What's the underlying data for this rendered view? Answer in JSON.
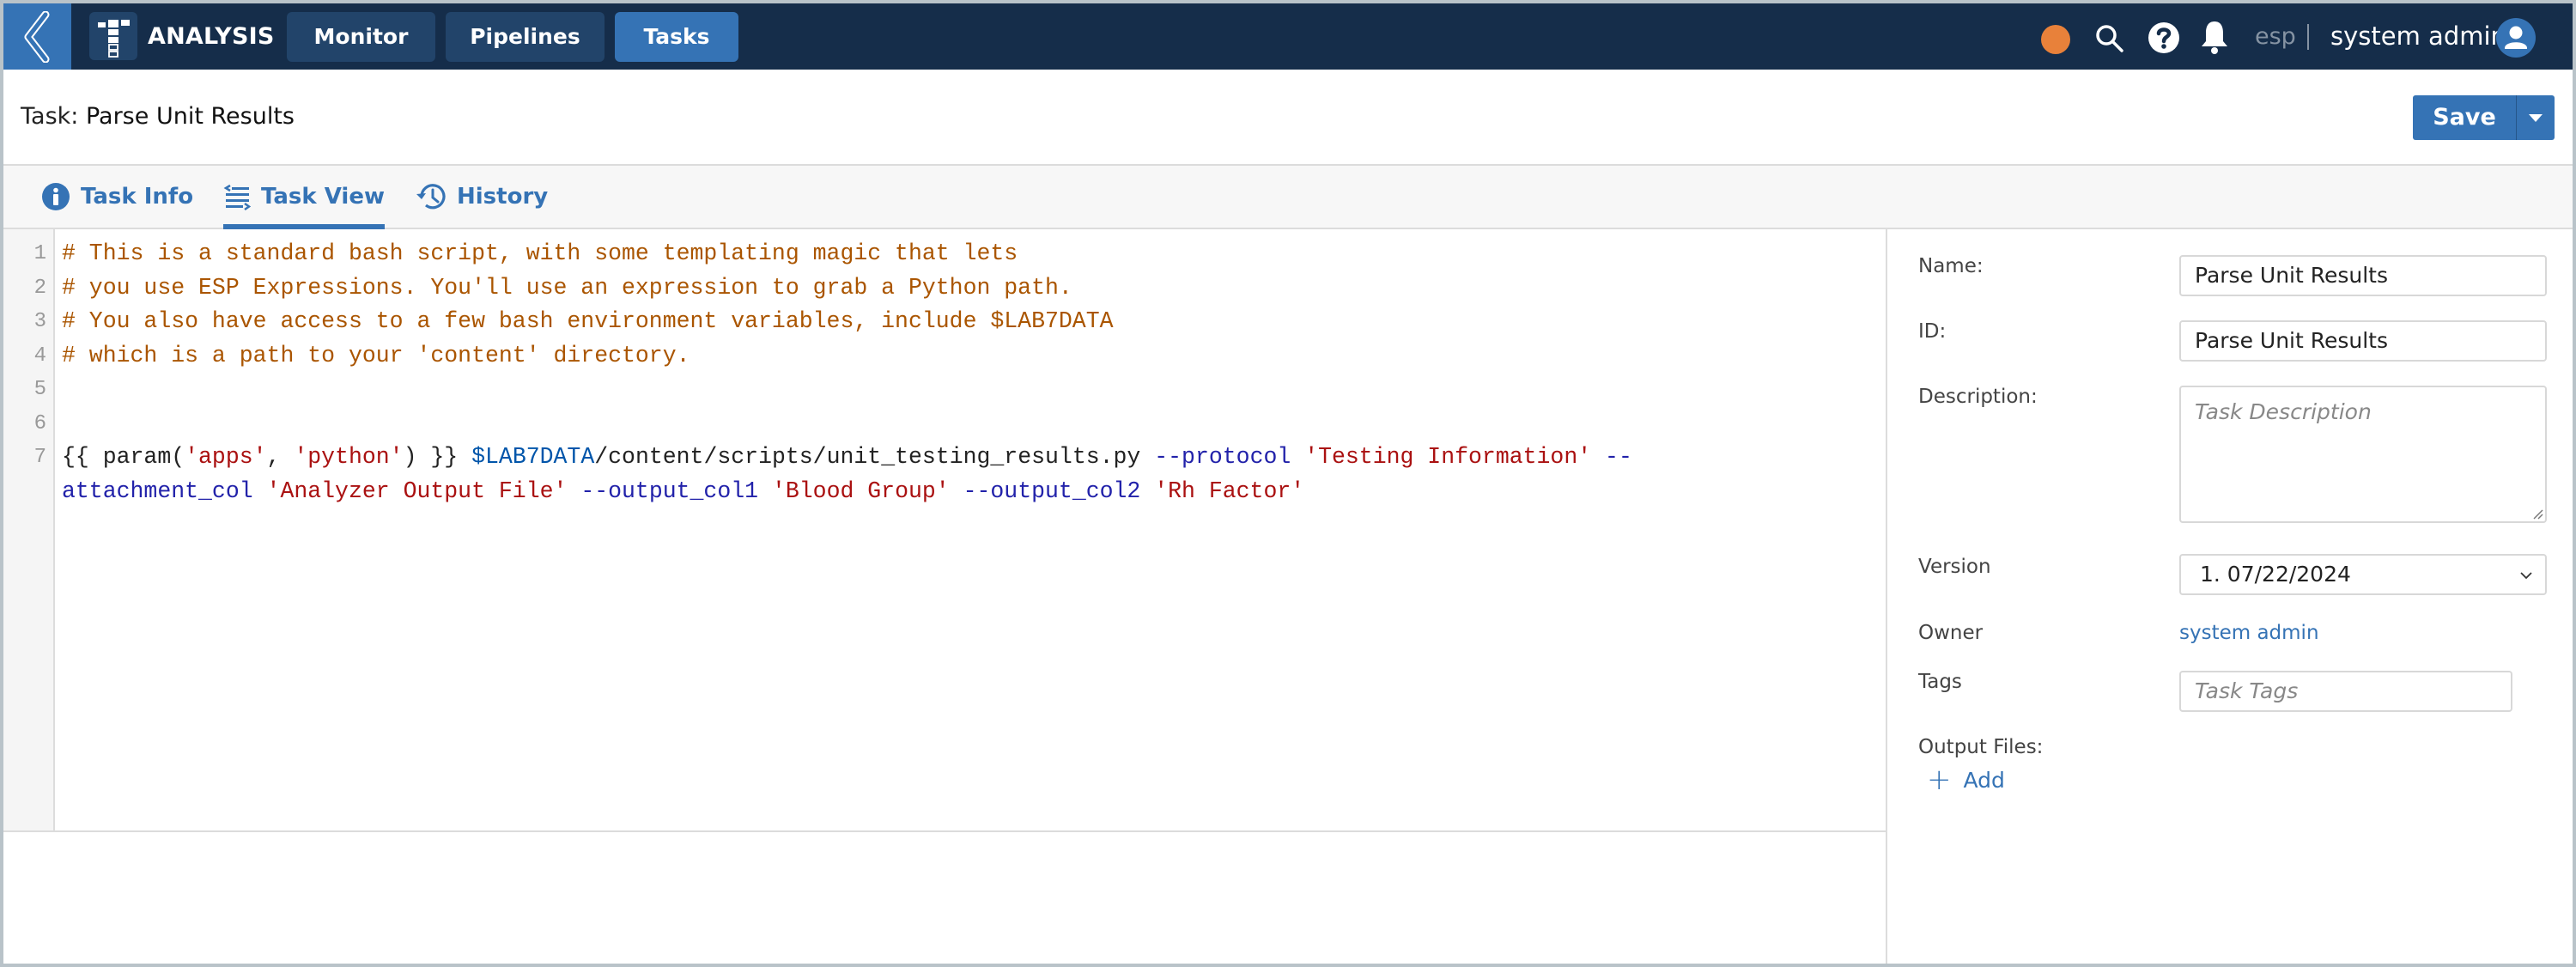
{
  "header": {
    "app_name": "ANALYSIS",
    "nav": [
      {
        "label": "Monitor",
        "active": false
      },
      {
        "label": "Pipelines",
        "active": false
      },
      {
        "label": "Tasks",
        "active": true
      }
    ],
    "icons": [
      "back-chevron-icon",
      "app-logo-icon",
      "status-dot-icon",
      "search-icon",
      "help-icon",
      "bell-icon",
      "user-avatar-icon"
    ],
    "workspace": "esp",
    "separator": "|",
    "user_name": "system admin",
    "status_color": "#e8813a"
  },
  "title_row": {
    "prefix": "Task:",
    "name": "Parse Unit Results",
    "save_label": "Save"
  },
  "tabs": [
    {
      "label": "Task Info",
      "icon": "info-icon",
      "active": false
    },
    {
      "label": "Task View",
      "icon": "list-view-icon",
      "active": true
    },
    {
      "label": "History",
      "icon": "history-icon",
      "active": false
    }
  ],
  "editor": {
    "line_numbers": [
      "1",
      "2",
      "3",
      "4",
      "5",
      "6",
      "7"
    ],
    "lines": [
      [
        {
          "t": "# This is a standard bash script, with some templating magic that lets",
          "c": "comment"
        }
      ],
      [
        {
          "t": "# you use ESP Expressions. You'll use an expression to grab a Python path.",
          "c": "comment"
        }
      ],
      [
        {
          "t": "# You also have access to a few bash environment variables, include $LAB7DATA",
          "c": "comment"
        }
      ],
      [
        {
          "t": "# which is a path to your 'content' directory.",
          "c": "comment"
        }
      ],
      [],
      [],
      [
        {
          "t": "{{ param(",
          "c": "plain"
        },
        {
          "t": "'apps'",
          "c": "string"
        },
        {
          "t": ", ",
          "c": "plain"
        },
        {
          "t": "'python'",
          "c": "string"
        },
        {
          "t": ") }} ",
          "c": "plain"
        },
        {
          "t": "$LAB7DATA",
          "c": "var"
        },
        {
          "t": "/content/scripts/unit_testing_results.py ",
          "c": "plain"
        },
        {
          "t": "--protocol",
          "c": "flag"
        },
        {
          "t": " ",
          "c": "plain"
        },
        {
          "t": "'Testing Information'",
          "c": "string"
        },
        {
          "t": " --",
          "c": "flag"
        }
      ],
      [
        {
          "t": "attachment_col",
          "c": "flag"
        },
        {
          "t": " ",
          "c": "plain"
        },
        {
          "t": "'Analyzer Output File'",
          "c": "string"
        },
        {
          "t": " ",
          "c": "plain"
        },
        {
          "t": "--output_col1",
          "c": "flag"
        },
        {
          "t": " ",
          "c": "plain"
        },
        {
          "t": "'Blood Group'",
          "c": "string"
        },
        {
          "t": " ",
          "c": "plain"
        },
        {
          "t": "--output_col2",
          "c": "flag"
        },
        {
          "t": " ",
          "c": "plain"
        },
        {
          "t": "'Rh Factor'",
          "c": "string"
        }
      ]
    ]
  },
  "form": {
    "name_label": "Name:",
    "name_value": "Parse Unit Results",
    "id_label": "ID:",
    "id_value": "Parse Unit Results",
    "description_label": "Description:",
    "description_placeholder": "Task Description",
    "version_label": "Version",
    "version_value": "1. 07/22/2024",
    "owner_label": "Owner",
    "owner_value": "system admin",
    "tags_label": "Tags",
    "tags_placeholder": "Task Tags",
    "output_files_label": "Output Files:",
    "add_label": "Add"
  },
  "colors": {
    "header_bg": "#152d4a",
    "accent": "#3573b5",
    "nav_inactive": "#22446a"
  }
}
